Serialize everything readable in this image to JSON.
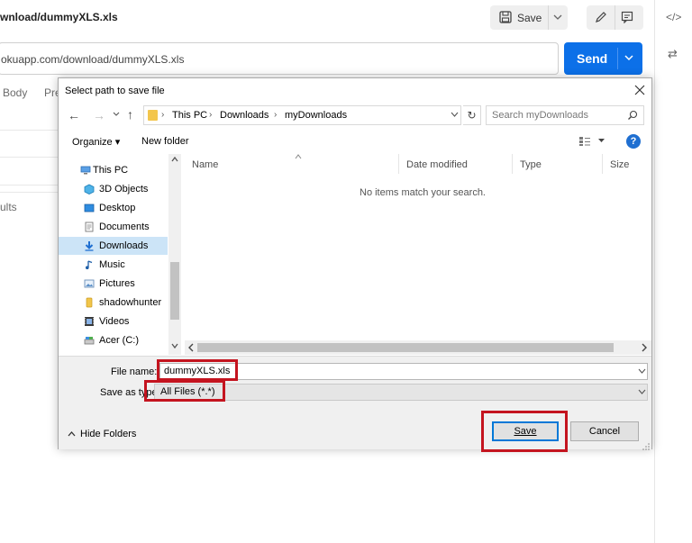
{
  "app": {
    "request_title": "wnload/dummyXLS.xls",
    "save_label": "Save",
    "url_value": "okuapp.com/download/dummyXLS.xls",
    "send_label": "Send",
    "tabs": [
      "Body",
      "Pre"
    ],
    "results_label": "ults"
  },
  "dialog": {
    "title": "Select path to save file",
    "address": {
      "segments": [
        "This PC",
        "Downloads",
        "myDownloads"
      ]
    },
    "search_placeholder": "Search myDownloads",
    "toolbar": {
      "organize": "Organize ▾",
      "new_folder": "New folder",
      "help": "?"
    },
    "nav_items": [
      {
        "label": "This PC",
        "icon": "computer-icon"
      },
      {
        "label": "3D Objects",
        "icon": "cube-icon"
      },
      {
        "label": "Desktop",
        "icon": "desktop-icon"
      },
      {
        "label": "Documents",
        "icon": "document-icon"
      },
      {
        "label": "Downloads",
        "icon": "download-icon",
        "selected": true
      },
      {
        "label": "Music",
        "icon": "music-icon"
      },
      {
        "label": "Pictures",
        "icon": "picture-icon"
      },
      {
        "label": "shadowhunter",
        "icon": "user-folder-icon"
      },
      {
        "label": "Videos",
        "icon": "video-icon"
      },
      {
        "label": "Acer (C:)",
        "icon": "drive-icon"
      }
    ],
    "columns": [
      "Name",
      "Date modified",
      "Type",
      "Size"
    ],
    "empty_message": "No items match your search.",
    "file_name_label": "File name:",
    "file_name_value": "dummyXLS.xls",
    "save_type_label": "Save as type:",
    "save_type_value": "All Files (*.*)",
    "hide_folders": "Hide Folders",
    "save_button": "Save",
    "cancel_button": "Cancel"
  },
  "colors": {
    "accent": "#0c70e8",
    "highlight": "#c4141f",
    "selection": "#cce4f7"
  }
}
